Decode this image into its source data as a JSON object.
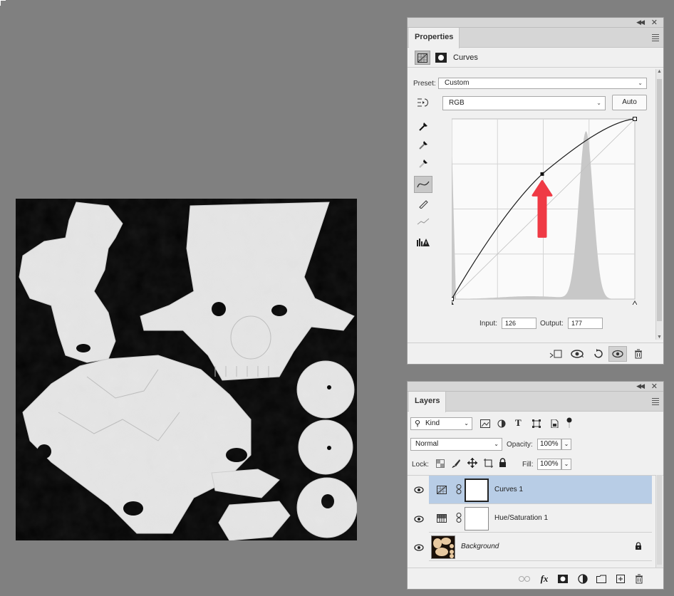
{
  "properties": {
    "tab_label": "Properties",
    "adjustment_name": "Curves",
    "preset_label": "Preset:",
    "preset_value": "Custom",
    "channel_value": "RGB",
    "auto_label": "Auto",
    "input_label": "Input:",
    "input_value": "126",
    "output_label": "Output:",
    "output_value": "177"
  },
  "curves": {
    "selected_point": {
      "input": 126,
      "output": 177
    },
    "curve_color": "#1a1a1a",
    "arrow_color": "#ef3a45"
  },
  "layers": {
    "tab_label": "Layers",
    "filter_kind": "Kind",
    "blend_mode": "Normal",
    "opacity_label": "Opacity:",
    "opacity_value": "100%",
    "lock_label": "Lock:",
    "fill_label": "Fill:",
    "fill_value": "100%",
    "items": [
      {
        "name": "Curves 1"
      },
      {
        "name": "Hue/Saturation 1"
      },
      {
        "name": "Background"
      }
    ],
    "selected_color": "#b8cde6"
  }
}
